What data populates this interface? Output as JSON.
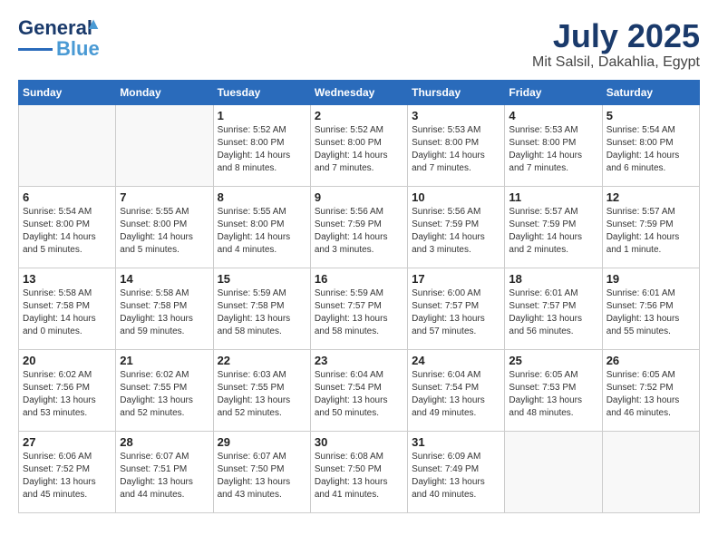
{
  "header": {
    "logo_line1": "General",
    "logo_line2": "Blue",
    "month": "July 2025",
    "location": "Mit Salsil, Dakahlia, Egypt"
  },
  "weekdays": [
    "Sunday",
    "Monday",
    "Tuesday",
    "Wednesday",
    "Thursday",
    "Friday",
    "Saturday"
  ],
  "weeks": [
    [
      {
        "day": "",
        "info": ""
      },
      {
        "day": "",
        "info": ""
      },
      {
        "day": "1",
        "info": "Sunrise: 5:52 AM\nSunset: 8:00 PM\nDaylight: 14 hours and 8 minutes."
      },
      {
        "day": "2",
        "info": "Sunrise: 5:52 AM\nSunset: 8:00 PM\nDaylight: 14 hours and 7 minutes."
      },
      {
        "day": "3",
        "info": "Sunrise: 5:53 AM\nSunset: 8:00 PM\nDaylight: 14 hours and 7 minutes."
      },
      {
        "day": "4",
        "info": "Sunrise: 5:53 AM\nSunset: 8:00 PM\nDaylight: 14 hours and 7 minutes."
      },
      {
        "day": "5",
        "info": "Sunrise: 5:54 AM\nSunset: 8:00 PM\nDaylight: 14 hours and 6 minutes."
      }
    ],
    [
      {
        "day": "6",
        "info": "Sunrise: 5:54 AM\nSunset: 8:00 PM\nDaylight: 14 hours and 5 minutes."
      },
      {
        "day": "7",
        "info": "Sunrise: 5:55 AM\nSunset: 8:00 PM\nDaylight: 14 hours and 5 minutes."
      },
      {
        "day": "8",
        "info": "Sunrise: 5:55 AM\nSunset: 8:00 PM\nDaylight: 14 hours and 4 minutes."
      },
      {
        "day": "9",
        "info": "Sunrise: 5:56 AM\nSunset: 7:59 PM\nDaylight: 14 hours and 3 minutes."
      },
      {
        "day": "10",
        "info": "Sunrise: 5:56 AM\nSunset: 7:59 PM\nDaylight: 14 hours and 3 minutes."
      },
      {
        "day": "11",
        "info": "Sunrise: 5:57 AM\nSunset: 7:59 PM\nDaylight: 14 hours and 2 minutes."
      },
      {
        "day": "12",
        "info": "Sunrise: 5:57 AM\nSunset: 7:59 PM\nDaylight: 14 hours and 1 minute."
      }
    ],
    [
      {
        "day": "13",
        "info": "Sunrise: 5:58 AM\nSunset: 7:58 PM\nDaylight: 14 hours and 0 minutes."
      },
      {
        "day": "14",
        "info": "Sunrise: 5:58 AM\nSunset: 7:58 PM\nDaylight: 13 hours and 59 minutes."
      },
      {
        "day": "15",
        "info": "Sunrise: 5:59 AM\nSunset: 7:58 PM\nDaylight: 13 hours and 58 minutes."
      },
      {
        "day": "16",
        "info": "Sunrise: 5:59 AM\nSunset: 7:57 PM\nDaylight: 13 hours and 58 minutes."
      },
      {
        "day": "17",
        "info": "Sunrise: 6:00 AM\nSunset: 7:57 PM\nDaylight: 13 hours and 57 minutes."
      },
      {
        "day": "18",
        "info": "Sunrise: 6:01 AM\nSunset: 7:57 PM\nDaylight: 13 hours and 56 minutes."
      },
      {
        "day": "19",
        "info": "Sunrise: 6:01 AM\nSunset: 7:56 PM\nDaylight: 13 hours and 55 minutes."
      }
    ],
    [
      {
        "day": "20",
        "info": "Sunrise: 6:02 AM\nSunset: 7:56 PM\nDaylight: 13 hours and 53 minutes."
      },
      {
        "day": "21",
        "info": "Sunrise: 6:02 AM\nSunset: 7:55 PM\nDaylight: 13 hours and 52 minutes."
      },
      {
        "day": "22",
        "info": "Sunrise: 6:03 AM\nSunset: 7:55 PM\nDaylight: 13 hours and 52 minutes."
      },
      {
        "day": "23",
        "info": "Sunrise: 6:04 AM\nSunset: 7:54 PM\nDaylight: 13 hours and 50 minutes."
      },
      {
        "day": "24",
        "info": "Sunrise: 6:04 AM\nSunset: 7:54 PM\nDaylight: 13 hours and 49 minutes."
      },
      {
        "day": "25",
        "info": "Sunrise: 6:05 AM\nSunset: 7:53 PM\nDaylight: 13 hours and 48 minutes."
      },
      {
        "day": "26",
        "info": "Sunrise: 6:05 AM\nSunset: 7:52 PM\nDaylight: 13 hours and 46 minutes."
      }
    ],
    [
      {
        "day": "27",
        "info": "Sunrise: 6:06 AM\nSunset: 7:52 PM\nDaylight: 13 hours and 45 minutes."
      },
      {
        "day": "28",
        "info": "Sunrise: 6:07 AM\nSunset: 7:51 PM\nDaylight: 13 hours and 44 minutes."
      },
      {
        "day": "29",
        "info": "Sunrise: 6:07 AM\nSunset: 7:50 PM\nDaylight: 13 hours and 43 minutes."
      },
      {
        "day": "30",
        "info": "Sunrise: 6:08 AM\nSunset: 7:50 PM\nDaylight: 13 hours and 41 minutes."
      },
      {
        "day": "31",
        "info": "Sunrise: 6:09 AM\nSunset: 7:49 PM\nDaylight: 13 hours and 40 minutes."
      },
      {
        "day": "",
        "info": ""
      },
      {
        "day": "",
        "info": ""
      }
    ]
  ]
}
